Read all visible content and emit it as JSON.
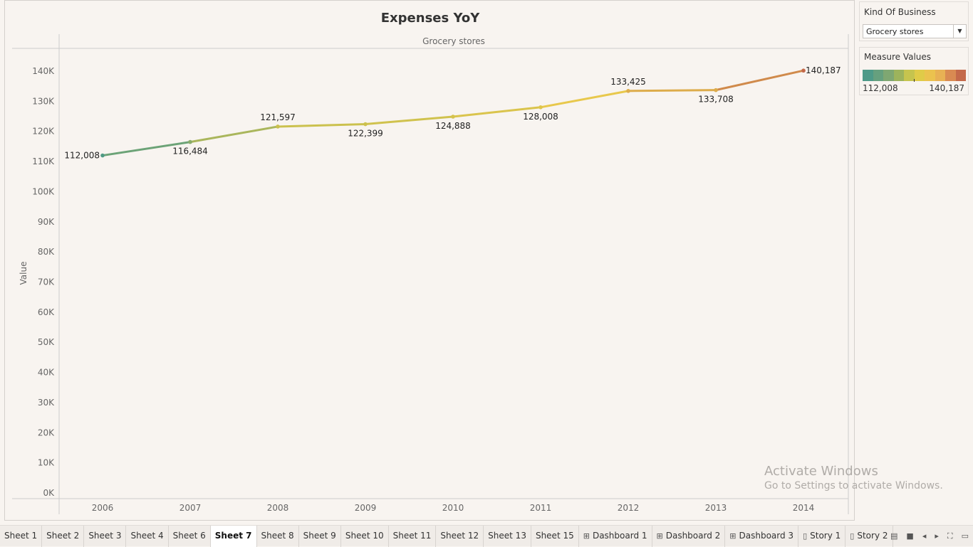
{
  "chart": {
    "title": "Expenses YoY",
    "pane_header": "Grocery stores",
    "ylabel": "Value"
  },
  "chart_data": {
    "type": "line",
    "title": "Expenses YoY",
    "subtitle": "Grocery stores",
    "ylabel": "Value",
    "xlabel": "",
    "x": [
      "2006",
      "2007",
      "2008",
      "2009",
      "2010",
      "2011",
      "2012",
      "2013",
      "2014"
    ],
    "values": [
      112008,
      116484,
      121597,
      122399,
      124888,
      128008,
      133425,
      133708,
      140187
    ],
    "data_labels": [
      "112,008",
      "116,484",
      "121,597",
      "122,399",
      "124,888",
      "128,008",
      "133,425",
      "133,708",
      "140,187"
    ],
    "label_position": [
      "left",
      "below",
      "above",
      "below",
      "below",
      "below",
      "above",
      "below",
      "right"
    ],
    "ylim": [
      0,
      140000
    ],
    "yticks": [
      0,
      10000,
      20000,
      30000,
      40000,
      50000,
      60000,
      70000,
      80000,
      90000,
      100000,
      110000,
      120000,
      130000,
      140000
    ],
    "ytick_labels": [
      "0K",
      "10K",
      "20K",
      "30K",
      "40K",
      "50K",
      "60K",
      "70K",
      "80K",
      "90K",
      "100K",
      "110K",
      "120K",
      "130K",
      "140K"
    ],
    "color_scale": [
      "#4f9a84",
      "#c9c04e",
      "#e8c84c",
      "#c4694a"
    ],
    "grid": false
  },
  "filter": {
    "title": "Kind Of Business",
    "value": "Grocery stores",
    "arrow": "▼"
  },
  "legend": {
    "title": "Measure Values",
    "min": "112,008",
    "max": "140,187",
    "swatches": [
      "#4e9a88",
      "#66a07e",
      "#7fa772",
      "#9db35c",
      "#c6c44e",
      "#e0cb48",
      "#ebc24e",
      "#e8b154",
      "#d98a52",
      "#c4694a"
    ]
  },
  "watermark": {
    "line1": "Activate Windows",
    "line2": "Go to Settings to activate Windows."
  },
  "tabs": [
    {
      "label": "Sheet 1",
      "icon": ""
    },
    {
      "label": "Sheet 2",
      "icon": ""
    },
    {
      "label": "Sheet 3",
      "icon": ""
    },
    {
      "label": "Sheet 4",
      "icon": ""
    },
    {
      "label": "Sheet 6",
      "icon": ""
    },
    {
      "label": "Sheet 7",
      "icon": "",
      "active": true
    },
    {
      "label": "Sheet 8",
      "icon": ""
    },
    {
      "label": "Sheet 9",
      "icon": ""
    },
    {
      "label": "Sheet 10",
      "icon": ""
    },
    {
      "label": "Sheet 11",
      "icon": ""
    },
    {
      "label": "Sheet 12",
      "icon": ""
    },
    {
      "label": "Sheet 13",
      "icon": ""
    },
    {
      "label": "Sheet 15",
      "icon": ""
    },
    {
      "label": "Dashboard 1",
      "icon": "dashboard-icon"
    },
    {
      "label": "Dashboard 2",
      "icon": "dashboard-icon"
    },
    {
      "label": "Dashboard 3",
      "icon": "dashboard-icon"
    },
    {
      "label": "Story 1",
      "icon": "story-icon"
    },
    {
      "label": "Story 2",
      "icon": "story-icon"
    }
  ],
  "controls": {
    "filmstrip": "▤",
    "single": "■",
    "prev": "◂",
    "next": "▸",
    "fullscreen": "⛶",
    "presentation": "▭"
  }
}
